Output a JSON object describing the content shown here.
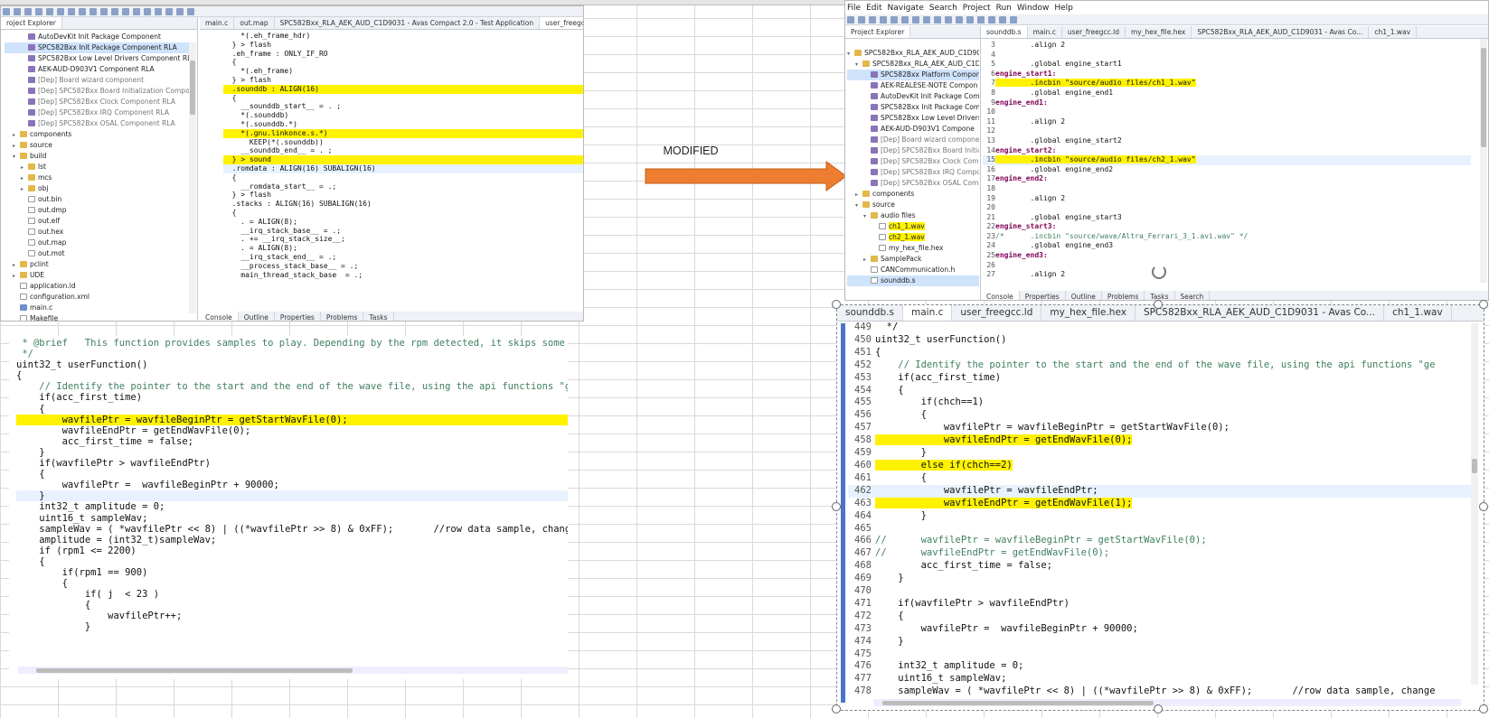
{
  "arrow": {
    "label": "MODIFIED"
  },
  "left_top": {
    "tree_title": "roject Explorer",
    "editor_tabs": [
      "main.c",
      "out.map",
      "SPC582Bxx_RLA_AEK_AUD_C1D9031 - Avas Compact 2.0 - Test Application",
      "user_freegcc.ld"
    ],
    "tree": [
      {
        "label": "AutoDevKit Init Package Component",
        "kind": "pkg",
        "indent": 2
      },
      {
        "label": "SPC582Bxx Init Package Component RLA",
        "kind": "pkg",
        "indent": 2,
        "selected": true
      },
      {
        "label": "SPC582Bxx Low Level Drivers Component RLA",
        "kind": "pkg",
        "indent": 2
      },
      {
        "label": "AEK-AUD-D903V1 Component RLA",
        "kind": "pkg",
        "indent": 2
      },
      {
        "label": "[Dep] Board wizard component",
        "kind": "pkg",
        "indent": 2,
        "dep": true
      },
      {
        "label": "[Dep] SPC582Bxx Board Initialization Component",
        "kind": "pkg",
        "indent": 2,
        "dep": true
      },
      {
        "label": "[Dep] SPC582Bxx Clock Component RLA",
        "kind": "pkg",
        "indent": 2,
        "dep": true
      },
      {
        "label": "[Dep] SPC582Bxx IRQ Component RLA",
        "kind": "pkg",
        "indent": 2,
        "dep": true
      },
      {
        "label": "[Dep] SPC582Bxx OSAL Component RLA",
        "kind": "pkg",
        "indent": 2,
        "dep": true
      },
      {
        "label": "components",
        "kind": "fold",
        "indent": 1,
        "tw": ">"
      },
      {
        "label": "source",
        "kind": "fold",
        "indent": 1,
        "tw": ">"
      },
      {
        "label": "build",
        "kind": "fold",
        "indent": 1,
        "tw": "v"
      },
      {
        "label": "lst",
        "kind": "fold",
        "indent": 2,
        "tw": ">"
      },
      {
        "label": "mcs",
        "kind": "fold",
        "indent": 2,
        "tw": ">"
      },
      {
        "label": "obj",
        "kind": "fold",
        "indent": 2,
        "tw": ">"
      },
      {
        "label": "out.bin",
        "kind": "file",
        "indent": 2
      },
      {
        "label": "out.dmp",
        "kind": "file",
        "indent": 2
      },
      {
        "label": "out.elf",
        "kind": "file",
        "indent": 2
      },
      {
        "label": "out.hex",
        "kind": "file",
        "indent": 2
      },
      {
        "label": "out.map",
        "kind": "file",
        "indent": 2
      },
      {
        "label": "out.mot",
        "kind": "file",
        "indent": 2
      },
      {
        "label": "pclint",
        "kind": "fold",
        "indent": 1,
        "tw": ">"
      },
      {
        "label": "UDE",
        "kind": "fold",
        "indent": 1,
        "tw": ">"
      },
      {
        "label": "application.ld",
        "kind": "file",
        "indent": 1
      },
      {
        "label": "configuration.xml",
        "kind": "file",
        "indent": 1
      },
      {
        "label": "main.c",
        "kind": "c",
        "indent": 1
      },
      {
        "label": "Makefile",
        "kind": "file",
        "indent": 1
      }
    ],
    "linker_lines": [
      "    *(.eh_frame_hdr)",
      "  } > flash",
      "",
      "  .eh_frame : ONLY_IF_RO",
      "  {",
      "    *(.eh_frame)",
      "  } > flash",
      "",
      "  .sounddb : ALIGN(16)",
      "  {",
      "    __sounddb_start__ = . ;",
      "    *(.sounddb)",
      "    *(.sounddb.*)",
      "    *(.gnu.linkonce.s.*)",
      "      KEEP(*(.sounddb))",
      "    __sounddb_end__ = . ;",
      "  } > sound",
      "",
      "  .romdata : ALIGN(16) SUBALIGN(16)",
      "  {",
      "    __romdata_start__ = .;",
      "  } > flash",
      "",
      "  .stacks : ALIGN(16) SUBALIGN(16)",
      "  {",
      "    . = ALIGN(8);",
      "    __irq_stack_base__ = .;",
      "    . += __irq_stack_size__;",
      "    . = ALIGN(8);",
      "    __irq_stack_end__ = .;",
      "    __process_stack_base__ = .;",
      "    main_thread_stack_base  = .;"
    ],
    "bottom_tabs": [
      "Console",
      "Outline",
      "Properties",
      "Problems",
      "Tasks"
    ]
  },
  "left_bottom": {
    "code_lines": [
      " * @brief   This function provides samples to play. Depending by the rpm detected, it skips some s",
      " */",
      "uint32_t userFunction()",
      "{",
      "    // Identify the pointer to the start and the end of the wave file, using the api functions \"ge",
      "    if(acc_first_time)",
      "    {",
      "        wavfilePtr = wavfileBeginPtr = getStartWavFile(0);",
      "        wavfileEndPtr = getEndWavFile(0);",
      "        acc_first_time = false;",
      "    }",
      "",
      "    if(wavfilePtr > wavfileEndPtr)",
      "    {",
      "        wavfilePtr =  wavfileBeginPtr + 90000;",
      "    }",
      "",
      "    int32_t amplitude = 0;",
      "    uint16_t sampleWav;",
      "    sampleWav = ( *wavfilePtr << 8) | ((*wavfilePtr >> 8) & 0xFF);       //row data sample, change",
      "    amplitude = (int32_t)sampleWav;",
      "",
      "    if (rpm1 <= 2200)",
      "    {",
      "        if(rpm1 == 900)",
      "        {",
      "            if( j  < 23 )",
      "            {",
      "                wavfilePtr++;",
      "            }"
    ]
  },
  "right_top": {
    "menu": [
      "File",
      "Edit",
      "Navigate",
      "Search",
      "Project",
      "Run",
      "Window",
      "Help"
    ],
    "tree_title": "Project Explorer",
    "tree": [
      {
        "label": "SPC582Bxx_RLA_AEK_AUD_C1D903",
        "kind": "fold",
        "indent": 0,
        "tw": "v"
      },
      {
        "label": "SPC582Bxx_RLA_AEK_AUD_C1D9",
        "kind": "fold",
        "indent": 1,
        "tw": "v"
      },
      {
        "label": "SPC582Bxx Platform Compon",
        "kind": "pkg",
        "indent": 2,
        "selected": true
      },
      {
        "label": "AEK-REALESE-NOTE Compon",
        "kind": "pkg",
        "indent": 2
      },
      {
        "label": "AutoDevKit Init Package Com",
        "kind": "pkg",
        "indent": 2
      },
      {
        "label": "SPC582Bxx Init Package Comp",
        "kind": "pkg",
        "indent": 2
      },
      {
        "label": "SPC582Bxx Low Level Drivers",
        "kind": "pkg",
        "indent": 2
      },
      {
        "label": "AEK-AUD-D903V1 Compone",
        "kind": "pkg",
        "indent": 2
      },
      {
        "label": "[Dep] Board wizard compone",
        "kind": "pkg",
        "indent": 2,
        "dep": true
      },
      {
        "label": "[Dep] SPC582Bxx Board Initia",
        "kind": "pkg",
        "indent": 2,
        "dep": true
      },
      {
        "label": "[Dep] SPC582Bxx Clock Comp",
        "kind": "pkg",
        "indent": 2,
        "dep": true
      },
      {
        "label": "[Dep] SPC582Bxx IRQ Compo",
        "kind": "pkg",
        "indent": 2,
        "dep": true
      },
      {
        "label": "[Dep] SPC582Bxx OSAL Comp",
        "kind": "pkg",
        "indent": 2,
        "dep": true
      },
      {
        "label": "components",
        "kind": "fold",
        "indent": 1,
        "tw": ">"
      },
      {
        "label": "source",
        "kind": "fold",
        "indent": 1,
        "tw": "v"
      },
      {
        "label": "audio files",
        "kind": "fold",
        "indent": 2,
        "tw": "v"
      },
      {
        "label": "ch1_1.wav",
        "kind": "file",
        "indent": 3,
        "hl": true
      },
      {
        "label": "ch2_1.wav",
        "kind": "file",
        "indent": 3,
        "hl": true
      },
      {
        "label": "my_hex_file.hex",
        "kind": "file",
        "indent": 3
      },
      {
        "label": "SamplePack",
        "kind": "fold",
        "indent": 2,
        "tw": ">"
      },
      {
        "label": "CANCommunication.h",
        "kind": "file",
        "indent": 2
      },
      {
        "label": "sounddb.s",
        "kind": "file",
        "indent": 2,
        "selected": true
      }
    ],
    "editor_tabs": [
      "sounddb.s",
      "main.c",
      "user_freegcc.ld",
      "my_hex_file.hex",
      "SPC582Bxx_RLA_AEK_AUD_C1D9031 - Avas Co...",
      "ch1_1.wav"
    ],
    "asm_lines": [
      {
        "n": "3",
        "t": "        .align 2"
      },
      {
        "n": "4",
        "t": ""
      },
      {
        "n": "5",
        "t": "        .global engine_start1"
      },
      {
        "n": "6",
        "t": "engine_start1:"
      },
      {
        "n": "7",
        "t": "        .incbin \"source/audio files/ch1_1.wav\""
      },
      {
        "n": "8",
        "t": "        .global engine_end1"
      },
      {
        "n": "9",
        "t": "engine_end1:"
      },
      {
        "n": "10",
        "t": ""
      },
      {
        "n": "11",
        "t": "        .align 2"
      },
      {
        "n": "12",
        "t": ""
      },
      {
        "n": "13",
        "t": "        .global engine_start2"
      },
      {
        "n": "14",
        "t": "engine_start2:"
      },
      {
        "n": "15",
        "t": "        .incbin \"source/audio files/ch2_1.wav\""
      },
      {
        "n": "16",
        "t": "        .global engine_end2"
      },
      {
        "n": "17",
        "t": "engine_end2:"
      },
      {
        "n": "18",
        "t": ""
      },
      {
        "n": "19",
        "t": "        .align 2"
      },
      {
        "n": "20",
        "t": ""
      },
      {
        "n": "21",
        "t": "        .global engine_start3"
      },
      {
        "n": "22",
        "t": "engine_start3:"
      },
      {
        "n": "23",
        "t": "/*      .incbin \"source/wave/Altra_Ferrari_3_1.avi.wav\" */"
      },
      {
        "n": "24",
        "t": "        .global engine_end3"
      },
      {
        "n": "25",
        "t": "engine_end3:"
      },
      {
        "n": "26",
        "t": ""
      },
      {
        "n": "27",
        "t": "        .align 2"
      }
    ],
    "bottom_tabs": [
      "Console",
      "Properties",
      "Outline",
      "Problems",
      "Tasks",
      "Search"
    ]
  },
  "right_bottom": {
    "editor_tabs": [
      "sounddb.s",
      "main.c",
      "user_freegcc.ld",
      "my_hex_file.hex",
      "SPC582Bxx_RLA_AEK_AUD_C1D9031 - Avas Co...",
      "ch1_1.wav"
    ],
    "lines": [
      {
        "n": "449",
        "t": "  */"
      },
      {
        "n": "450",
        "t": "uint32_t userFunction()"
      },
      {
        "n": "451",
        "t": "{"
      },
      {
        "n": "452",
        "t": "    // Identify the pointer to the start and the end of the wave file, using the api functions \"ge"
      },
      {
        "n": "453",
        "t": "    if(acc_first_time)"
      },
      {
        "n": "454",
        "t": "    {"
      },
      {
        "n": "455",
        "t": "        if(chch==1)"
      },
      {
        "n": "456",
        "t": "        {"
      },
      {
        "n": "457",
        "t": "            wavfilePtr = wavfileBeginPtr = getStartWavFile(0);"
      },
      {
        "n": "458",
        "t": "            wavfileEndPtr = getEndWavFile(0);"
      },
      {
        "n": "459",
        "t": "        }"
      },
      {
        "n": "460",
        "t": "        else if(chch==2)"
      },
      {
        "n": "461",
        "t": "        {"
      },
      {
        "n": "462",
        "t": "            wavfilePtr = wavfileEndPtr;"
      },
      {
        "n": "463",
        "t": "            wavfileEndPtr = getEndWavFile(1);"
      },
      {
        "n": "464",
        "t": "        }"
      },
      {
        "n": "465",
        "t": ""
      },
      {
        "n": "466",
        "t": "//      wavfilePtr = wavfileBeginPtr = getStartWavFile(0);"
      },
      {
        "n": "467",
        "t": "//      wavfileEndPtr = getEndWavFile(0);"
      },
      {
        "n": "468",
        "t": "        acc_first_time = false;"
      },
      {
        "n": "469",
        "t": "    }"
      },
      {
        "n": "470",
        "t": ""
      },
      {
        "n": "471",
        "t": "    if(wavfilePtr > wavfileEndPtr)"
      },
      {
        "n": "472",
        "t": "    {"
      },
      {
        "n": "473",
        "t": "        wavfilePtr =  wavfileBeginPtr + 90000;"
      },
      {
        "n": "474",
        "t": "    }"
      },
      {
        "n": "475",
        "t": ""
      },
      {
        "n": "476",
        "t": "    int32_t amplitude = 0;"
      },
      {
        "n": "477",
        "t": "    uint16_t sampleWav;"
      },
      {
        "n": "478",
        "t": "    sampleWav = ( *wavfilePtr << 8) | ((*wavfilePtr >> 8) & 0xFF);       //row data sample, change"
      }
    ]
  },
  "colors": {
    "highlight": "#fff200",
    "arrow": "#ed7d31",
    "selection": "#2f6fd6"
  }
}
